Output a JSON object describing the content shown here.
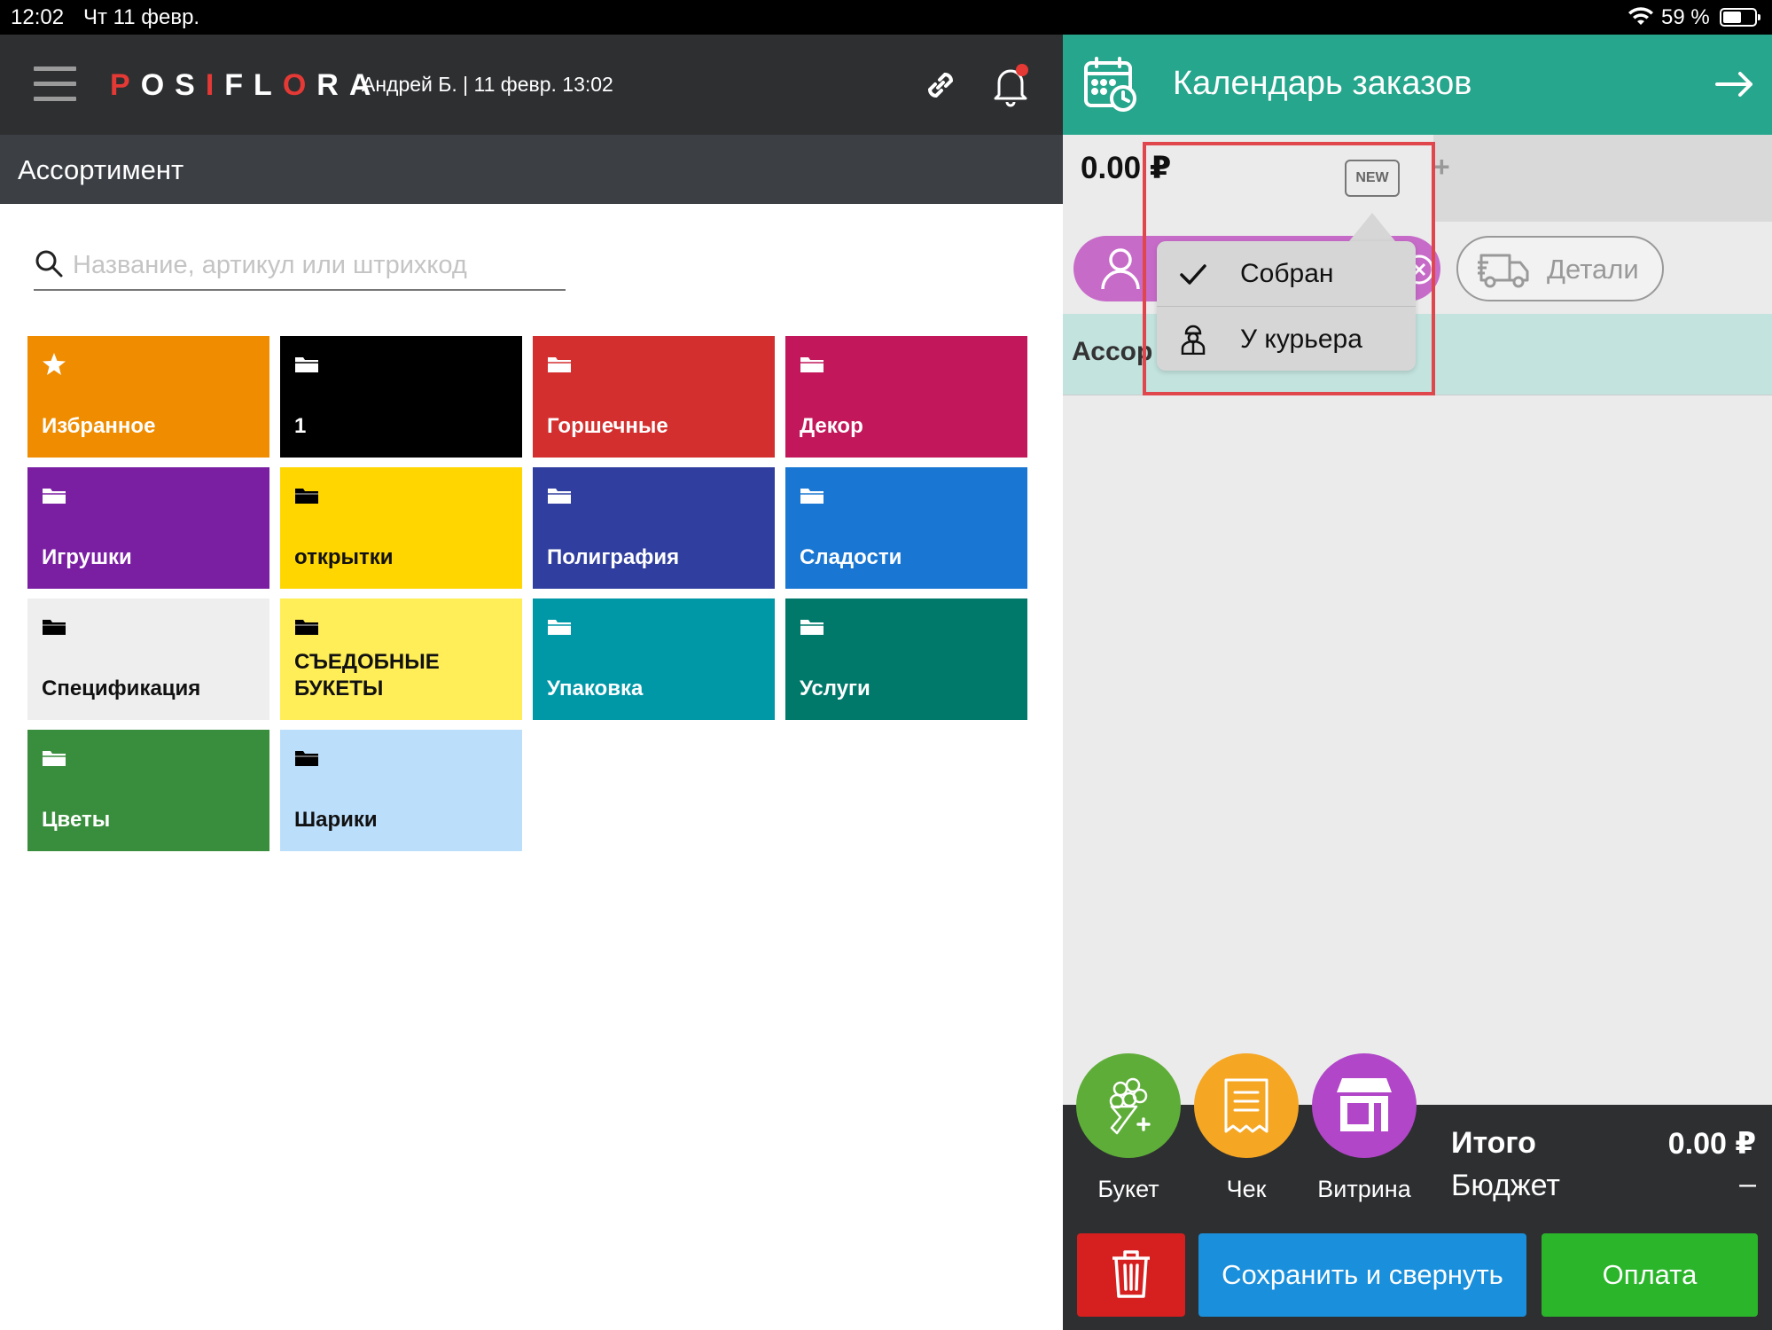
{
  "status_bar": {
    "time": "12:02",
    "date": "Чт 11 февр.",
    "battery_percent": "59 %",
    "battery_level": 0.59
  },
  "header": {
    "logo_parts": [
      "P",
      "OS",
      "I",
      "FL",
      "O",
      "R",
      "A"
    ],
    "user_info": "Андрей Б.  | 11 февр. 13:02",
    "link_icon": "link-icon",
    "bell_icon": "bell-icon",
    "bell_has_notification": true
  },
  "section": {
    "title": "Ассортимент"
  },
  "search": {
    "placeholder": "Название, артикул или штрихкод",
    "value": ""
  },
  "categories": [
    {
      "label": "Избранное",
      "icon": "star-icon",
      "color": "#f08c00"
    },
    {
      "label": "1",
      "icon": "folder-icon",
      "color": "#000000"
    },
    {
      "label": "Горшечные",
      "icon": "folder-icon",
      "color": "#d32f2f"
    },
    {
      "label": "Декор",
      "icon": "folder-icon",
      "color": "#c2185b"
    },
    {
      "label": "Игрушки",
      "icon": "folder-icon",
      "color": "#7b1fa2"
    },
    {
      "label": "открытки",
      "icon": "folder-icon",
      "color": "#ffd600"
    },
    {
      "label": "Полиграфия",
      "icon": "folder-icon",
      "color": "#303f9f"
    },
    {
      "label": "Сладости",
      "icon": "folder-icon",
      "color": "#1976d2"
    },
    {
      "label": "Спецификация",
      "icon": "folder-icon",
      "color": "#eeeeee"
    },
    {
      "label": "СЪЕДОБНЫЕ БУКЕТЫ",
      "icon": "folder-icon",
      "color": "#ffee58"
    },
    {
      "label": "Упаковка",
      "icon": "folder-icon",
      "color": "#0097a7"
    },
    {
      "label": "Услуги",
      "icon": "folder-icon",
      "color": "#00796b"
    },
    {
      "label": "Цветы",
      "icon": "folder-icon",
      "color": "#388e3c"
    },
    {
      "label": "Шарики",
      "icon": "folder-icon",
      "color": "#bbdefb"
    }
  ],
  "right_panel": {
    "title": "Календарь заказов",
    "order_amount": "0.00 ₽",
    "new_badge": "NEW",
    "add_tab": "+",
    "details_label": "Детали",
    "assortment_label": "Ассор",
    "accent_color": "#26a68c"
  },
  "status_popup": {
    "items": [
      {
        "label": "Собран",
        "icon": "checkmark-icon"
      },
      {
        "label": "У курьера",
        "icon": "courier-icon"
      }
    ]
  },
  "actions": {
    "bouquet_label": "Букет",
    "receipt_label": "Чек",
    "showcase_label": "Витрина"
  },
  "totals": {
    "total_label": "Итого",
    "total_value": "0.00 ₽",
    "budget_label": "Бюджет",
    "budget_value": "–"
  },
  "buttons": {
    "save_label": "Сохранить и свернуть",
    "pay_label": "Оплата"
  }
}
